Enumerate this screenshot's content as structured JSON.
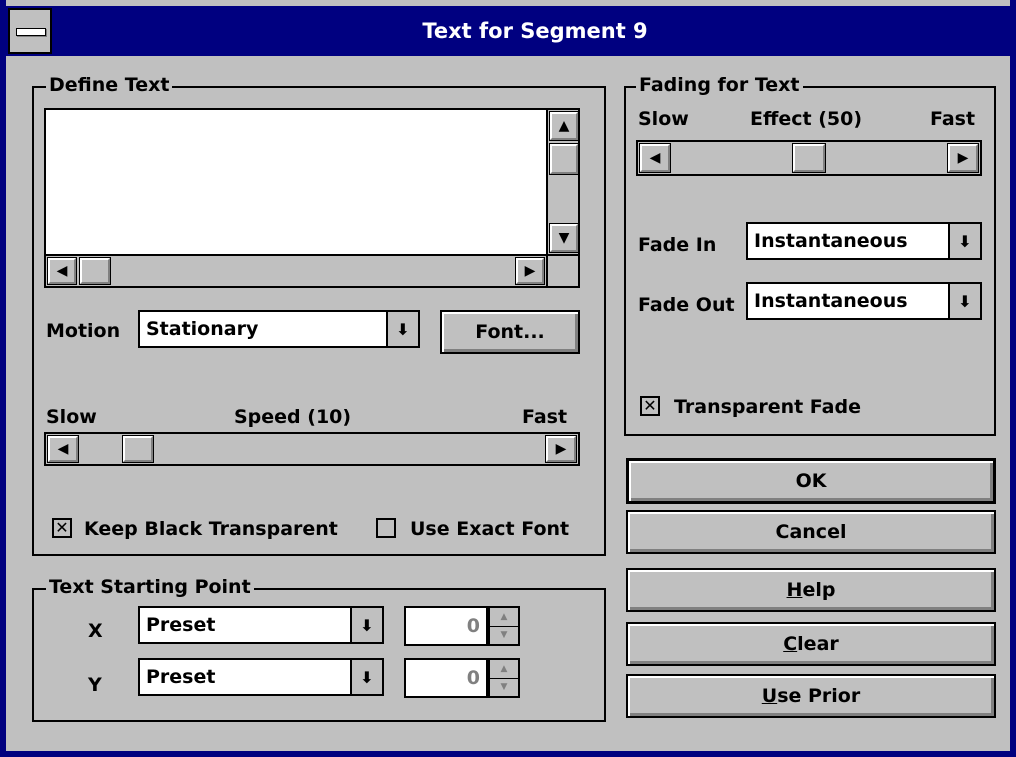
{
  "window": {
    "title": "Text for Segment 9",
    "sys_menu_icon": "system-menu-icon"
  },
  "define_text": {
    "group_label": "Define Text",
    "text_value": "",
    "motion_label": "Motion",
    "motion_value": "Stationary",
    "font_button": "Font...",
    "speed_slow": "Slow",
    "speed_label": "Speed (10)",
    "speed_fast": "Fast",
    "speed_value": 10,
    "keep_black_label": "Keep Black Transparent",
    "keep_black_checked": true,
    "exact_font_label": "Use Exact Font",
    "exact_font_checked": false
  },
  "starting_point": {
    "group_label": "Text Starting Point",
    "x_label": "X",
    "x_mode": "Preset",
    "x_value": "0",
    "y_label": "Y",
    "y_mode": "Preset",
    "y_value": "0"
  },
  "fading": {
    "group_label": "Fading for Text",
    "effect_slow": "Slow",
    "effect_label": "Effect (50)",
    "effect_fast": "Fast",
    "effect_value": 50,
    "fade_in_label": "Fade In",
    "fade_in_value": "Instantaneous",
    "fade_out_label": "Fade Out",
    "fade_out_value": "Instantaneous",
    "transparent_fade_label": "Transparent Fade",
    "transparent_fade_checked": true
  },
  "buttons": {
    "ok": "OK",
    "cancel": "Cancel",
    "help_mnemonic": "H",
    "help_rest": "elp",
    "clear_mnemonic": "C",
    "clear_rest": "lear",
    "use_prior_mnemonic": "U",
    "use_prior_rest": "se Prior"
  },
  "glyphs": {
    "arrow_up": "▲",
    "arrow_down": "▼",
    "arrow_left": "◀",
    "arrow_right": "▶",
    "dropdown": "⬇",
    "check": "✕"
  }
}
